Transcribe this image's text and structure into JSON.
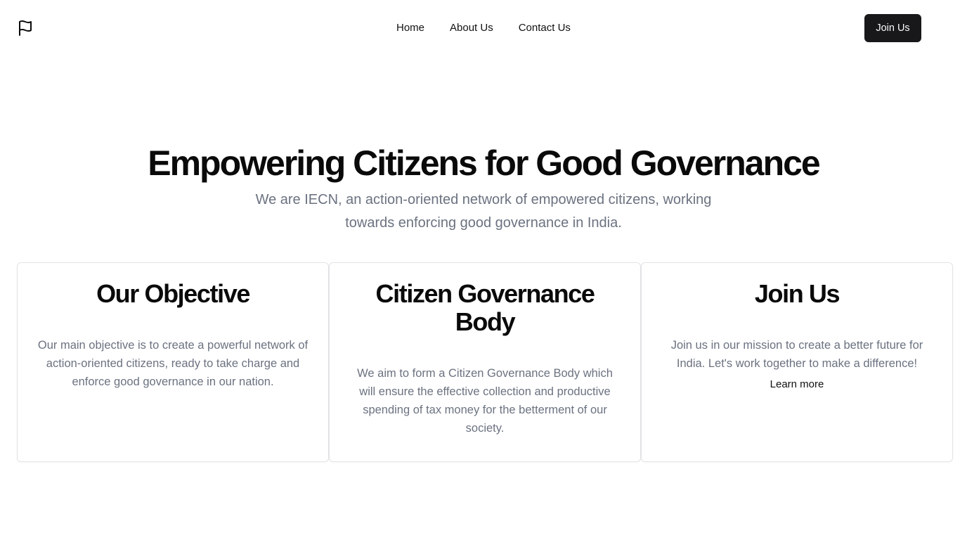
{
  "header": {
    "logo_icon": "flag-icon",
    "nav": [
      "Home",
      "About Us",
      "Contact Us"
    ],
    "join_label": "Join Us"
  },
  "hero": {
    "title": "Empowering Citizens for Good Governance",
    "subtitle": "We are IECN, an action-oriented network of empowered citizens, working towards enforcing good governance in India."
  },
  "cards": [
    {
      "title": "Our Objective",
      "text": "Our main objective is to create a powerful network of action-oriented citizens, ready to take charge and enforce good governance in our nation."
    },
    {
      "title": "Citizen Governance Body",
      "text": "We aim to form a Citizen Governance Body which will ensure the effective collection and productive spending of tax money for the betterment of our society."
    },
    {
      "title": "Join Us",
      "text": "Join us in our mission to create a better future for India. Let's work together to make a difference!",
      "link": "Learn more"
    }
  ],
  "colors": {
    "primary_button": "#18181b",
    "muted_text": "#6b7280",
    "border": "#e4e4e7"
  }
}
